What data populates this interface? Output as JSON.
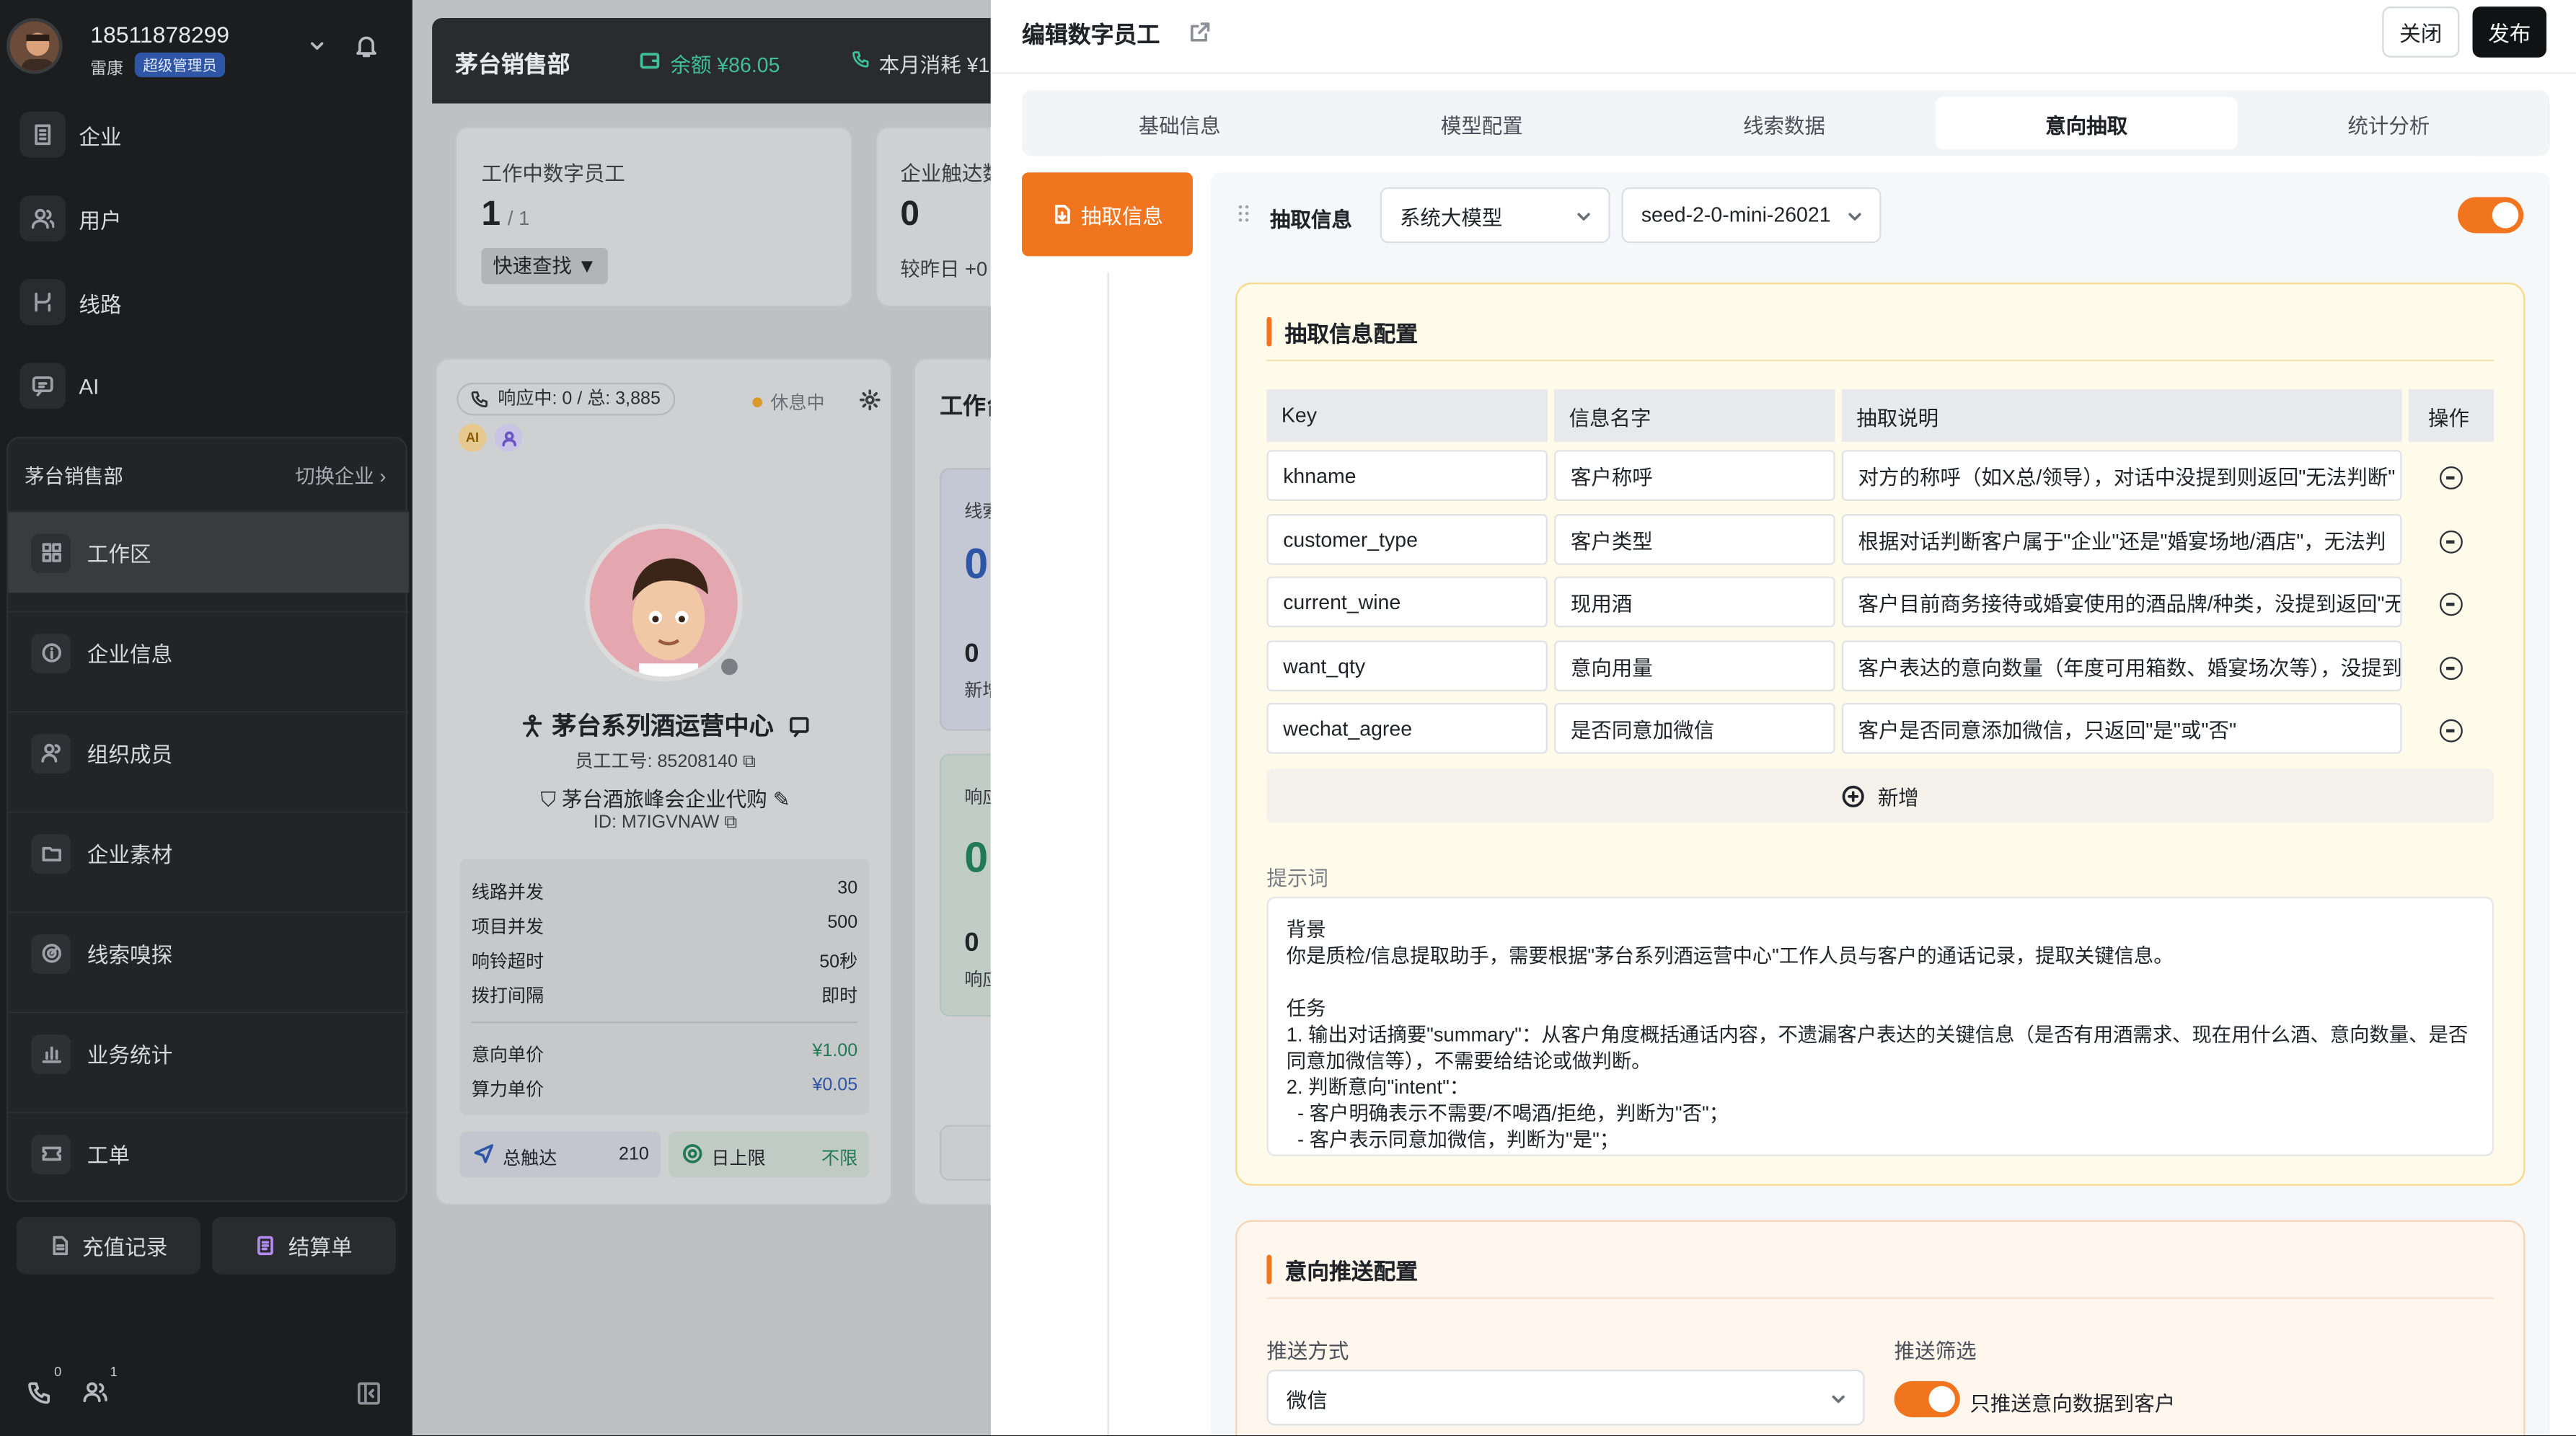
{
  "sidebar": {
    "phone": "18511878299",
    "user_name": "雷康",
    "role_badge": "超级管理员",
    "nav": [
      {
        "label": "企业",
        "icon": "building-icon"
      },
      {
        "label": "用户",
        "icon": "users-icon"
      },
      {
        "label": "线路",
        "icon": "route-icon"
      },
      {
        "label": "AI",
        "icon": "ai-chat-icon"
      }
    ],
    "workspace_name": "茅台销售部",
    "switch_label": "切换企业",
    "ws_items": [
      {
        "label": "工作区",
        "icon": "grid-icon"
      },
      {
        "label": "企业信息",
        "icon": "info-icon"
      },
      {
        "label": "组织成员",
        "icon": "members-icon"
      },
      {
        "label": "企业素材",
        "icon": "folder-icon"
      },
      {
        "label": "线索嗅探",
        "icon": "radar-icon"
      },
      {
        "label": "业务统计",
        "icon": "bar-chart-icon"
      },
      {
        "label": "工单",
        "icon": "ticket-icon"
      }
    ],
    "recharge_label": "充值记录",
    "statement_label": "结算单",
    "phone_count": "0",
    "team_count": "1"
  },
  "bg": {
    "dept": "茅台销售部",
    "balance": "余额 ¥86.05",
    "month_cost": "本月消耗 ¥1",
    "working_title": "工作中数字员工",
    "working_value": "1",
    "working_total": "/ 1",
    "quick_find": "快速查找 ▼",
    "reach_title": "企业触达数",
    "reach_value": "0",
    "reach_compare": "较昨日 +0",
    "status_line": "响应中: 0 / 总: 3,885",
    "rest_label": "休息中",
    "ai_badge": "AI",
    "agent_name": "茅台系列酒运营中心",
    "emp_no": "员工工号: 85208140",
    "company": "茅台酒旅峰会企业代购",
    "emp_id": "ID: M7IGVNAW",
    "stats": [
      {
        "k": "线路并发",
        "v": "30"
      },
      {
        "k": "项目并发",
        "v": "500"
      },
      {
        "k": "响铃超时",
        "v": "50秒"
      },
      {
        "k": "拨打间隔",
        "v": "即时"
      }
    ],
    "price": [
      {
        "k": "意向单价",
        "v": "¥1.00"
      },
      {
        "k": "算力单价",
        "v": "¥0.05"
      }
    ],
    "total_reach_label": "总触达",
    "total_reach_value": "210",
    "day_limit_label": "日上限",
    "day_limit_value": "不限",
    "work_title": "工作台",
    "mini1_title": "线索",
    "mini1_value": "0",
    "mini1_sub_value": "0",
    "mini1_sub_label": "新增",
    "mini2_title": "响应",
    "mini2_value": "0",
    "mini2_sub_value": "0",
    "mini2_sub_label": "响应"
  },
  "drawer": {
    "title": "编辑数字员工",
    "close_label": "关闭",
    "publish_label": "发布",
    "tabs": [
      "基础信息",
      "模型配置",
      "线索数据",
      "意向抽取",
      "统计分析"
    ],
    "side_button": "抽取信息",
    "extract_label": "抽取信息",
    "model_type": "系统大模型",
    "model_name": "seed-2-0-mini-26021",
    "extract_enabled": true,
    "config_title": "抽取信息配置",
    "headers": {
      "key": "Key",
      "name": "信息名字",
      "desc": "抽取说明",
      "op": "操作"
    },
    "rows": [
      {
        "key": "khname",
        "name": "客户称呼",
        "desc": "对方的称呼（如X总/领导），对话中没提到则返回\"无法判断\""
      },
      {
        "key": "customer_type",
        "name": "客户类型",
        "desc": "根据对话判断客户属于\"企业\"还是\"婚宴场地/酒店\"，无法判"
      },
      {
        "key": "current_wine",
        "name": "现用酒",
        "desc": "客户目前商务接待或婚宴使用的酒品牌/种类，没提到返回\"无"
      },
      {
        "key": "want_qty",
        "name": "意向用量",
        "desc": "客户表达的意向数量（年度可用箱数、婚宴场次等），没提到返"
      },
      {
        "key": "wechat_agree",
        "name": "是否同意加微信",
        "desc": "客户是否同意添加微信，只返回\"是\"或\"否\""
      }
    ],
    "add_label": "新增",
    "prompt_label": "提示词",
    "prompt_text": "背景\n你是质检/信息提取助手，需要根据\"茅台系列酒运营中心\"工作人员与客户的通话记录，提取关键信息。\n\n任务\n1. 输出对话摘要\"summary\"：从客户角度概括通话内容，不遗漏客户表达的关键信息（是否有用酒需求、现在用什么酒、意向数量、是否同意加微信等），不需要给结论或做判断。\n2. 判断意向\"intent\"：\n  - 客户明确表示不需要/不喝酒/拒绝，判断为\"否\"；\n  - 客户表示同意加微信，判断为\"是\"；",
    "push_title": "意向推送配置",
    "push_method_label": "推送方式",
    "push_method_value": "微信",
    "push_filter_label": "推送筛选",
    "push_filter_text": "只推送意向数据到客户",
    "push_filter_enabled": true
  },
  "colors": {
    "accent": "#f0751e",
    "sidebar_bg": "#1c1d1f",
    "config_bg": "#fffbea",
    "push_bg": "#fff6ee"
  }
}
